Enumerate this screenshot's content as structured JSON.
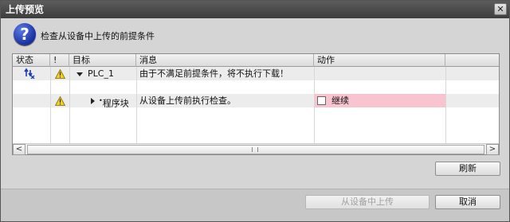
{
  "window": {
    "title": "上传预览",
    "close_glyph": "✕"
  },
  "header": {
    "icon_glyph": "?",
    "message": "检查从设备中上传的前提条件"
  },
  "grid": {
    "columns": [
      "状态",
      "!",
      "目标",
      "消息",
      "动作"
    ],
    "rows": [
      {
        "status_icon": "status-sync-icon",
        "warning": true,
        "expander": "collapse",
        "target": "PLC_1",
        "message": "由于不满足前提条件，将不执行下载！",
        "action": ""
      },
      {
        "status_icon": "",
        "warning": true,
        "expander": "expand",
        "target": "程序块",
        "message": "从设备上传前执行检查。",
        "action": "继续",
        "action_checked": false
      }
    ]
  },
  "buttons": {
    "refresh": "刷新",
    "upload": "从设备中上传",
    "cancel": "取消"
  },
  "colors": {
    "titlebar": "#3d3d3d",
    "action_highlight": "#f8c4cf",
    "warning": "#f2d21b"
  }
}
